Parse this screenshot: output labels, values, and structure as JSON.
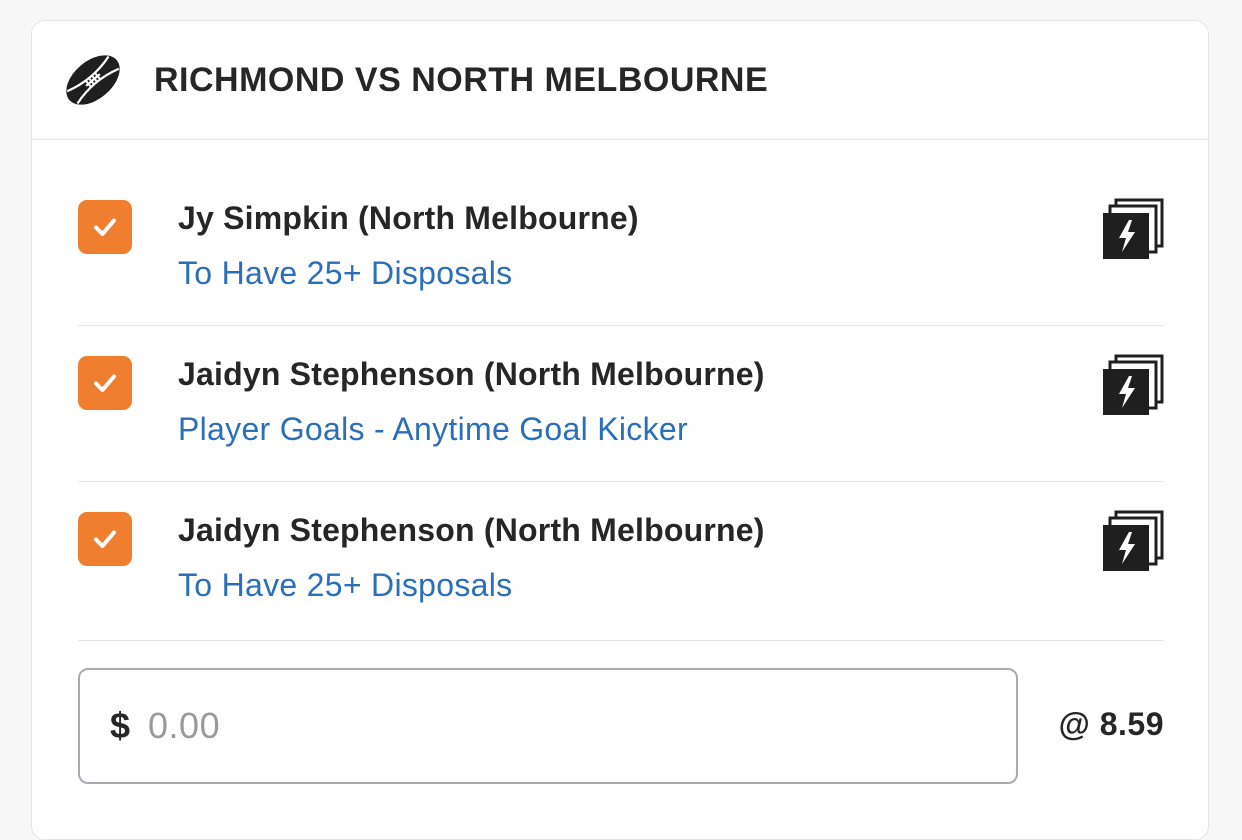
{
  "match": {
    "title": "RICHMOND VS NORTH MELBOURNE",
    "icon": "football-icon"
  },
  "selections": [
    {
      "player": "Jy Simpkin (North Melbourne)",
      "market": "To Have 25+ Disposals",
      "checked": true,
      "icon": "quick-multi-icon"
    },
    {
      "player": "Jaidyn Stephenson (North Melbourne)",
      "market": "Player Goals - Anytime Goal Kicker",
      "checked": true,
      "icon": "quick-multi-icon"
    },
    {
      "player": "Jaidyn Stephenson (North Melbourne)",
      "market": "To Have 25+ Disposals",
      "checked": true,
      "icon": "quick-multi-icon"
    }
  ],
  "stake": {
    "currency": "$",
    "placeholder": "0.00",
    "odds": "@ 8.59"
  },
  "colors": {
    "accent": "#ef7f2f",
    "link": "#2a6fb8",
    "text": "#262626"
  }
}
